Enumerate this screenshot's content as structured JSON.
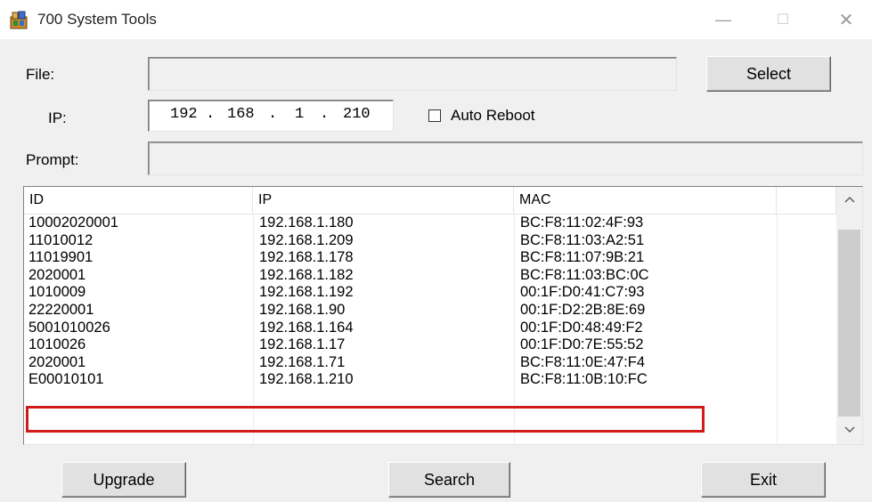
{
  "window": {
    "title": "700 System Tools",
    "minimize": "—",
    "maximize": "☐",
    "close": "✕"
  },
  "form": {
    "file_label": "File:",
    "file_value": "",
    "select_button": "Select",
    "ip_label": "IP:",
    "ip_segments": [
      "192",
      "168",
      "1",
      "210"
    ],
    "auto_reboot_label": "Auto Reboot",
    "auto_reboot_checked": false,
    "prompt_label": "Prompt:",
    "prompt_value": ""
  },
  "table": {
    "columns": [
      "ID",
      "IP",
      "MAC"
    ],
    "rows": [
      [
        "10002020001",
        "192.168.1.180",
        "BC:F8:11:02:4F:93"
      ],
      [
        "11010012",
        "192.168.1.209",
        "BC:F8:11:03:A2:51"
      ],
      [
        "11019901",
        "192.168.1.178",
        "BC:F8:11:07:9B:21"
      ],
      [
        "2020001",
        "192.168.1.182",
        "BC:F8:11:03:BC:0C"
      ],
      [
        "1010009",
        "192.168.1.192",
        "00:1F:D0:41:C7:93"
      ],
      [
        "22220001",
        "192.168.1.90",
        "00:1F:D2:2B:8E:69"
      ],
      [
        "5001010026",
        "192.168.1.164",
        "00:1F:D0:48:49:F2"
      ],
      [
        "1010026",
        "192.168.1.17",
        "00:1F:D0:7E:55:52"
      ],
      [
        "2020001",
        "192.168.1.71",
        "BC:F8:11:0E:47:F4"
      ],
      [
        "E00010101",
        "192.168.1.210",
        "BC:F8:11:0B:10:FC"
      ]
    ],
    "highlighted_row": 9,
    "highlight_color": "#d11a1a"
  },
  "buttons": {
    "upgrade": "Upgrade",
    "search": "Search",
    "exit": "Exit"
  },
  "icons": {
    "app": "app-icon",
    "scroll_up": "chevron-up-icon",
    "scroll_down": "chevron-down-icon"
  }
}
